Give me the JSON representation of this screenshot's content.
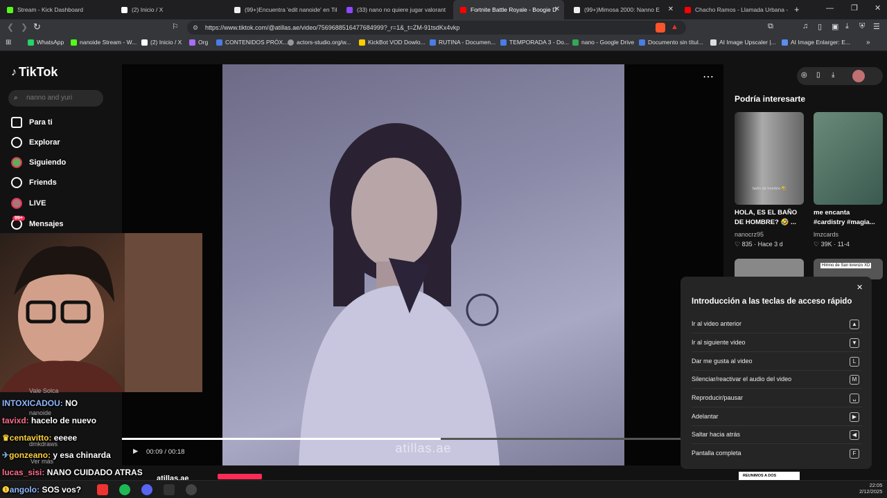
{
  "tabs": [
    {
      "label": "Stream - Kick Dashboard",
      "color": "#53fc18",
      "active": false
    },
    {
      "label": "(2) Inicio / X",
      "color": "#ffffff",
      "active": false
    },
    {
      "label": "(99+)Encuentra 'edit nanoide' en Tik",
      "color": "#ffffff",
      "active": false
    },
    {
      "label": "(33) nano no quiere jugar valorant",
      "color": "#9146ff",
      "active": false
    },
    {
      "label": "Fortnite Battle Royale - Boogie D",
      "color": "#ff0000",
      "active": true
    },
    {
      "label": "(99+)Mimosa 2000: Nanno E",
      "color": "#ffffff",
      "active": false
    },
    {
      "label": "Chacho Ramos - Llamada Urbana - Y",
      "color": "#ff0000",
      "active": false
    }
  ],
  "address": {
    "url": "https://www.tiktok.com/@atillas.ae/video/7569688516477684999?_r=1&_t=ZM-91tsdKx4vkp"
  },
  "bookmarks": [
    "WhatsApp",
    "nanoide Stream - W...",
    "(2) Inicio / X",
    "Org",
    "CONTENIDOS PRÓX...",
    "actors-studio.org/w...",
    "KickBot VOD Dowlo...",
    "RUTINA - Documen...",
    "TEMPORADA 3 - Do...",
    "nano - Google Drive",
    "Documento sin títul...",
    "AI Image Upscaler |...",
    "AI Image Enlarger: E..."
  ],
  "tiktok": {
    "logo": "TikTok",
    "search_placeholder": "nanno and yuri",
    "nav": [
      "Para ti",
      "Explorar",
      "Siguiendo",
      "Friends",
      "LIVE",
      "Mensajes"
    ],
    "messages_badge": "99+",
    "watermark": "atillas.ae",
    "time": "00:09 / 00:18",
    "progress": 0.53,
    "author": "atillas.ae",
    "sidebar_title": "Podría interesarte",
    "cards": [
      {
        "title": "HOLA, ES EL BAÑO DE HOMBRE? 🤣 ...",
        "user": "nanocrz95",
        "stats": "♡ 835 · Hace 3 d",
        "caption": "baño de hombre 🤣"
      },
      {
        "title": "me encanta #cardistry #magia...",
        "user": "lmzcards",
        "stats": "♡ 39K · 11-4",
        "caption": ""
      }
    ],
    "card3_caption": "Himno de San lorenzo XD",
    "card4_caption": "REUNIMOS A DOS"
  },
  "shortcuts": {
    "title": "Introducción a las teclas de acceso rápido",
    "items": [
      {
        "label": "Ir al video anterior",
        "key": "▲"
      },
      {
        "label": "Ir al siguiente video",
        "key": "▼"
      },
      {
        "label": "Dar me gusta al video",
        "key": "L"
      },
      {
        "label": "Silenciar/reactivar el audio del video",
        "key": "M"
      },
      {
        "label": "Reproducir/pausar",
        "key": "␣"
      },
      {
        "label": "Adelantar",
        "key": "▶"
      },
      {
        "label": "Saltar hacia atrás",
        "key": "◀"
      },
      {
        "label": "Pantalla completa",
        "key": "F"
      }
    ]
  },
  "chat": [
    {
      "user": "INTOXICADOU:",
      "msg": "NO",
      "color": "#8fb8ff"
    },
    {
      "user": "tavixd:",
      "msg": "hacelo de nuevo",
      "color": "#ff6b8b"
    },
    {
      "user": "centavitto:",
      "msg": "eeeee",
      "color": "#ffd23c"
    },
    {
      "user": "gonzeano:",
      "msg": "y esa chinarda",
      "color": "#ffd23c"
    },
    {
      "user": "lucas_sisi:",
      "msg": "NANO CUIDADO ATRAS",
      "color": "#ff6b8b"
    },
    {
      "user": "angolo:",
      "msg": "SOS vos?",
      "color": "#8fb8ff"
    }
  ],
  "chat_bg": [
    "Vale Solca",
    "nanoide",
    "dmkdraws",
    "Ver más"
  ],
  "taskbar": {
    "time": "22:05",
    "date": "2/12/2025"
  }
}
